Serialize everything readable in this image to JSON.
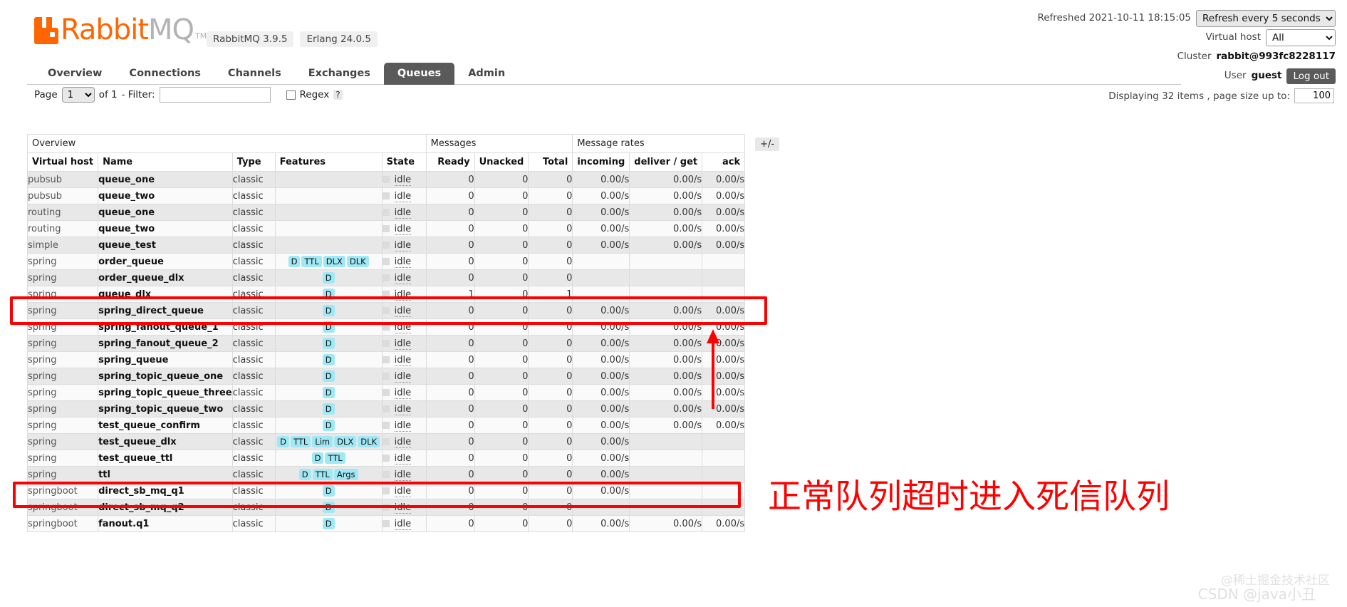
{
  "brand": {
    "name_part1": "Rabbit",
    "name_part2": "MQ",
    "tm": "TM",
    "badges": [
      "RabbitMQ 3.9.5",
      "Erlang 24.0.5"
    ],
    "accent_color": "#ff6600"
  },
  "header": {
    "refreshed_label": "Refreshed 2021-10-11 18:15:05",
    "refresh_interval": "Refresh every 5 seconds",
    "vhost_label": "Virtual host",
    "vhost_value": "All",
    "cluster_label": "Cluster",
    "cluster_value": "rabbit@993fc8228117",
    "user_label": "User",
    "user_value": "guest",
    "logout_label": "Log out"
  },
  "nav": {
    "tabs": [
      {
        "label": "Overview",
        "active": false
      },
      {
        "label": "Connections",
        "active": false
      },
      {
        "label": "Channels",
        "active": false
      },
      {
        "label": "Exchanges",
        "active": false
      },
      {
        "label": "Queues",
        "active": true
      },
      {
        "label": "Admin",
        "active": false
      }
    ]
  },
  "filterbar": {
    "page_label": "Page",
    "page_value": "1",
    "of_label": "of 1",
    "filter_label": "- Filter:",
    "filter_value": "",
    "filter_placeholder": "",
    "regex_label": "Regex",
    "help_label": "?",
    "displaying_label": "Displaying 32 items , page size up to:",
    "page_size_value": "100"
  },
  "table": {
    "group_headers": [
      {
        "label": "Overview",
        "span": 5
      },
      {
        "label": "Messages",
        "span": 3
      },
      {
        "label": "Message rates",
        "span": 3
      }
    ],
    "plus_minus_label": "+/-",
    "columns": [
      "Virtual host",
      "Name",
      "Type",
      "Features",
      "State",
      "Ready",
      "Unacked",
      "Total",
      "incoming",
      "deliver / get",
      "ack"
    ],
    "rows": [
      {
        "vhost": "pubsub",
        "name": "queue_one",
        "type": "classic",
        "features": [],
        "state": "idle",
        "ready": "0",
        "unacked": "0",
        "total": "0",
        "incoming": "0.00/s",
        "deliver_get": "0.00/s",
        "ack": "0.00/s"
      },
      {
        "vhost": "pubsub",
        "name": "queue_two",
        "type": "classic",
        "features": [],
        "state": "idle",
        "ready": "0",
        "unacked": "0",
        "total": "0",
        "incoming": "0.00/s",
        "deliver_get": "0.00/s",
        "ack": "0.00/s"
      },
      {
        "vhost": "routing",
        "name": "queue_one",
        "type": "classic",
        "features": [],
        "state": "idle",
        "ready": "0",
        "unacked": "0",
        "total": "0",
        "incoming": "0.00/s",
        "deliver_get": "0.00/s",
        "ack": "0.00/s"
      },
      {
        "vhost": "routing",
        "name": "queue_two",
        "type": "classic",
        "features": [],
        "state": "idle",
        "ready": "0",
        "unacked": "0",
        "total": "0",
        "incoming": "0.00/s",
        "deliver_get": "0.00/s",
        "ack": "0.00/s"
      },
      {
        "vhost": "simple",
        "name": "queue_test",
        "type": "classic",
        "features": [],
        "state": "idle",
        "ready": "0",
        "unacked": "0",
        "total": "0",
        "incoming": "0.00/s",
        "deliver_get": "0.00/s",
        "ack": "0.00/s"
      },
      {
        "vhost": "spring",
        "name": "order_queue",
        "type": "classic",
        "features": [
          "D",
          "TTL",
          "DLX",
          "DLK"
        ],
        "state": "idle",
        "ready": "0",
        "unacked": "0",
        "total": "0",
        "incoming": "",
        "deliver_get": "",
        "ack": ""
      },
      {
        "vhost": "spring",
        "name": "order_queue_dlx",
        "type": "classic",
        "features": [
          "D"
        ],
        "state": "idle",
        "ready": "0",
        "unacked": "0",
        "total": "0",
        "incoming": "",
        "deliver_get": "",
        "ack": ""
      },
      {
        "vhost": "spring",
        "name": "queue_dlx",
        "type": "classic",
        "features": [
          "D"
        ],
        "state": "idle",
        "ready": "1",
        "unacked": "0",
        "total": "1",
        "incoming": "",
        "deliver_get": "",
        "ack": ""
      },
      {
        "vhost": "spring",
        "name": "spring_direct_queue",
        "type": "classic",
        "features": [
          "D"
        ],
        "state": "idle",
        "ready": "0",
        "unacked": "0",
        "total": "0",
        "incoming": "0.00/s",
        "deliver_get": "0.00/s",
        "ack": "0.00/s"
      },
      {
        "vhost": "spring",
        "name": "spring_fanout_queue_1",
        "type": "classic",
        "features": [
          "D"
        ],
        "state": "idle",
        "ready": "0",
        "unacked": "0",
        "total": "0",
        "incoming": "0.00/s",
        "deliver_get": "0.00/s",
        "ack": "0.00/s"
      },
      {
        "vhost": "spring",
        "name": "spring_fanout_queue_2",
        "type": "classic",
        "features": [
          "D"
        ],
        "state": "idle",
        "ready": "0",
        "unacked": "0",
        "total": "0",
        "incoming": "0.00/s",
        "deliver_get": "0.00/s",
        "ack": "0.00/s"
      },
      {
        "vhost": "spring",
        "name": "spring_queue",
        "type": "classic",
        "features": [
          "D"
        ],
        "state": "idle",
        "ready": "0",
        "unacked": "0",
        "total": "0",
        "incoming": "0.00/s",
        "deliver_get": "0.00/s",
        "ack": "0.00/s"
      },
      {
        "vhost": "spring",
        "name": "spring_topic_queue_one",
        "type": "classic",
        "features": [
          "D"
        ],
        "state": "idle",
        "ready": "0",
        "unacked": "0",
        "total": "0",
        "incoming": "0.00/s",
        "deliver_get": "0.00/s",
        "ack": "0.00/s"
      },
      {
        "vhost": "spring",
        "name": "spring_topic_queue_three",
        "type": "classic",
        "features": [
          "D"
        ],
        "state": "idle",
        "ready": "0",
        "unacked": "0",
        "total": "0",
        "incoming": "0.00/s",
        "deliver_get": "0.00/s",
        "ack": "0.00/s"
      },
      {
        "vhost": "spring",
        "name": "spring_topic_queue_two",
        "type": "classic",
        "features": [
          "D"
        ],
        "state": "idle",
        "ready": "0",
        "unacked": "0",
        "total": "0",
        "incoming": "0.00/s",
        "deliver_get": "0.00/s",
        "ack": "0.00/s"
      },
      {
        "vhost": "spring",
        "name": "test_queue_confirm",
        "type": "classic",
        "features": [
          "D"
        ],
        "state": "idle",
        "ready": "0",
        "unacked": "0",
        "total": "0",
        "incoming": "0.00/s",
        "deliver_get": "0.00/s",
        "ack": "0.00/s"
      },
      {
        "vhost": "spring",
        "name": "test_queue_dlx",
        "type": "classic",
        "features": [
          "D",
          "TTL",
          "Lim",
          "DLX",
          "DLK"
        ],
        "state": "idle",
        "ready": "0",
        "unacked": "0",
        "total": "0",
        "incoming": "0.00/s",
        "deliver_get": "",
        "ack": ""
      },
      {
        "vhost": "spring",
        "name": "test_queue_ttl",
        "type": "classic",
        "features": [
          "D",
          "TTL"
        ],
        "state": "idle",
        "ready": "0",
        "unacked": "0",
        "total": "0",
        "incoming": "0.00/s",
        "deliver_get": "",
        "ack": ""
      },
      {
        "vhost": "spring",
        "name": "ttl",
        "type": "classic",
        "features": [
          "D",
          "TTL",
          "Args"
        ],
        "state": "idle",
        "ready": "0",
        "unacked": "0",
        "total": "0",
        "incoming": "0.00/s",
        "deliver_get": "",
        "ack": ""
      },
      {
        "vhost": "springboot",
        "name": "direct_sb_mq_q1",
        "type": "classic",
        "features": [
          "D"
        ],
        "state": "idle",
        "ready": "0",
        "unacked": "0",
        "total": "0",
        "incoming": "0.00/s",
        "deliver_get": "",
        "ack": ""
      },
      {
        "vhost": "springboot",
        "name": "direct_sb_mq_q2",
        "type": "classic",
        "features": [
          "D"
        ],
        "state": "idle",
        "ready": "0",
        "unacked": "0",
        "total": "0",
        "incoming": "",
        "deliver_get": "",
        "ack": ""
      },
      {
        "vhost": "springboot",
        "name": "fanout.q1",
        "type": "classic",
        "features": [
          "D"
        ],
        "state": "idle",
        "ready": "0",
        "unacked": "0",
        "total": "0",
        "incoming": "0.00/s",
        "deliver_get": "0.00/s",
        "ack": "0.00/s"
      }
    ]
  },
  "annotations": {
    "callout_text": "正常队列超时进入死信队列",
    "callout_color": "#fe0000",
    "highlight_color": "#fe0000",
    "watermark_1": "@稀土掘金技术社区",
    "watermark_2": "CSDN @java小丑"
  }
}
